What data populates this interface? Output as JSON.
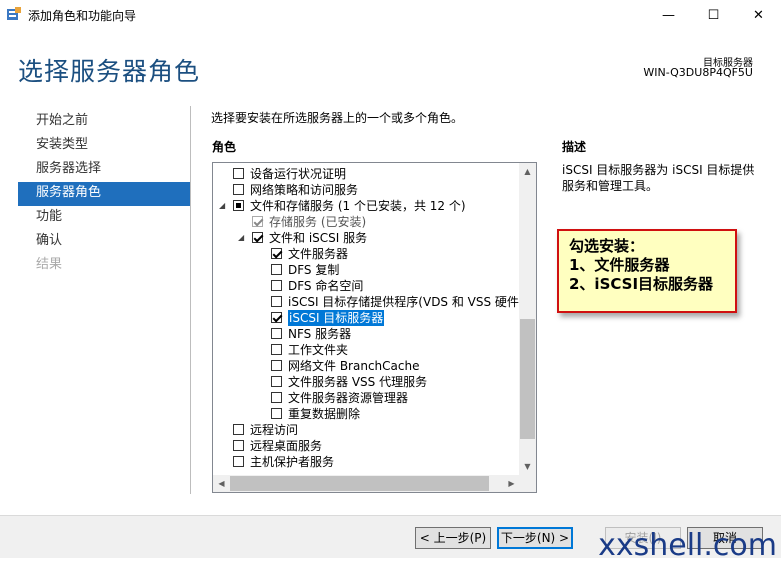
{
  "window": {
    "title": "添加角色和功能向导",
    "minimize_glyph": "—",
    "maximize_glyph": "☐",
    "close_glyph": "✕"
  },
  "header": {
    "page_title": "选择服务器角色",
    "server_label": "目标服务器",
    "server_name": "WIN-Q3DU8P4QF5U"
  },
  "nav": {
    "items": [
      {
        "label": "开始之前",
        "state": "normal"
      },
      {
        "label": "安装类型",
        "state": "normal"
      },
      {
        "label": "服务器选择",
        "state": "normal"
      },
      {
        "label": "服务器角色",
        "state": "active"
      },
      {
        "label": "功能",
        "state": "normal"
      },
      {
        "label": "确认",
        "state": "normal"
      },
      {
        "label": "结果",
        "state": "disabled"
      }
    ]
  },
  "main": {
    "intro": "选择要安装在所选服务器上的一个或多个角色。",
    "roles_label": "角色",
    "description_label": "描述",
    "description_text": "iSCSI 目标服务器为 iSCSI 目标提供服务和管理工具。"
  },
  "roles": [
    {
      "label": "设备运行状况证明",
      "state": "unchecked",
      "level": 0,
      "arrow": ""
    },
    {
      "label": "网络策略和访问服务",
      "state": "unchecked",
      "level": 0,
      "arrow": ""
    },
    {
      "label": "文件和存储服务 (1 个已安装，共 12 个)",
      "state": "partial",
      "level": 0,
      "arrow": "◢"
    },
    {
      "label": "存储服务 (已安装)",
      "state": "disabled-checked",
      "level": 1,
      "arrow": ""
    },
    {
      "label": "文件和 iSCSI 服务",
      "state": "checked",
      "level": 1,
      "arrow": "◢"
    },
    {
      "label": "文件服务器",
      "state": "checked",
      "level": 2,
      "arrow": ""
    },
    {
      "label": "DFS 复制",
      "state": "unchecked",
      "level": 2,
      "arrow": ""
    },
    {
      "label": "DFS 命名空间",
      "state": "unchecked",
      "level": 2,
      "arrow": ""
    },
    {
      "label": "iSCSI 目标存储提供程序(VDS 和 VSS 硬件提",
      "state": "unchecked",
      "level": 2,
      "arrow": ""
    },
    {
      "label": "iSCSI 目标服务器",
      "state": "checked",
      "level": 2,
      "arrow": "",
      "selected": true
    },
    {
      "label": "NFS 服务器",
      "state": "unchecked",
      "level": 2,
      "arrow": ""
    },
    {
      "label": "工作文件夹",
      "state": "unchecked",
      "level": 2,
      "arrow": ""
    },
    {
      "label": "网络文件 BranchCache",
      "state": "unchecked",
      "level": 2,
      "arrow": ""
    },
    {
      "label": "文件服务器 VSS 代理服务",
      "state": "unchecked",
      "level": 2,
      "arrow": ""
    },
    {
      "label": "文件服务器资源管理器",
      "state": "unchecked",
      "level": 2,
      "arrow": ""
    },
    {
      "label": "重复数据删除",
      "state": "unchecked",
      "level": 2,
      "arrow": ""
    },
    {
      "label": "远程访问",
      "state": "unchecked",
      "level": 0,
      "arrow": ""
    },
    {
      "label": "远程桌面服务",
      "state": "unchecked",
      "level": 0,
      "arrow": ""
    },
    {
      "label": "主机保护者服务",
      "state": "unchecked",
      "level": 0,
      "arrow": ""
    }
  ],
  "scroll": {
    "vertical_thumb_start": 0.5,
    "vertical_thumb_end": 0.93,
    "horizontal_thumb_start": 0.0,
    "horizontal_thumb_end": 0.95,
    "up_glyph": "▲",
    "down_glyph": "▼",
    "left_glyph": "◀",
    "right_glyph": "▶"
  },
  "annotation": {
    "line1": "勾选安装：",
    "line2": "1、文件服务器",
    "line3": "2、iSCSI目标服务器"
  },
  "footer": {
    "prev": "< 上一步(P)",
    "next": "下一步(N) >",
    "install": "安装(I)",
    "cancel": "取消"
  },
  "watermark": "xxshell.com",
  "colors": {
    "accent": "#1f6fbd",
    "heading": "#1b4f80",
    "selection": "#0078d7",
    "note_bg": "#ffffc0",
    "note_border": "#d01010"
  }
}
